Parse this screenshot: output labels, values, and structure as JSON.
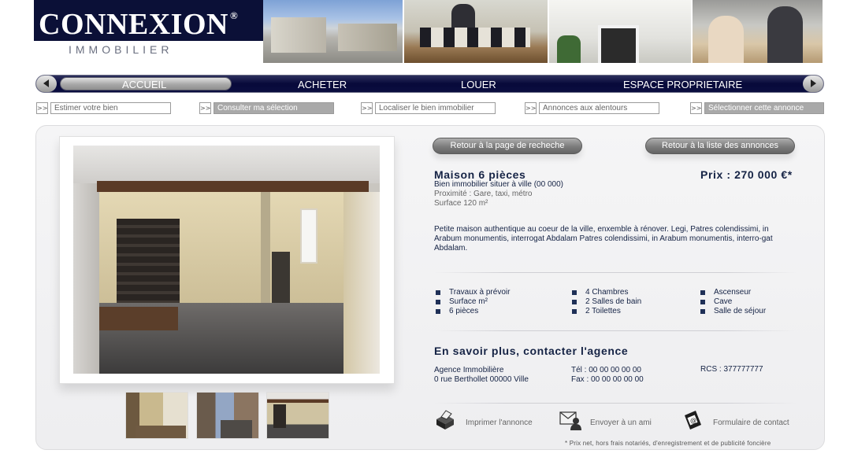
{
  "brand": {
    "name": "CONNEXION",
    "reg_mark": "®",
    "subtitle": "IMMOBILIER"
  },
  "nav": {
    "items": [
      "ACCUEIL",
      "ACHETER",
      "LOUER",
      "ESPACE PROPRIETAIRE"
    ],
    "active": "ACCUEIL",
    "prev_icon": "arrow-left-icon",
    "next_icon": "arrow-right-icon"
  },
  "sub_actions": [
    {
      "arrow": ">>",
      "label": "Estimer votre bien"
    },
    {
      "arrow": ">>",
      "label": "Consulter ma sélection"
    },
    {
      "arrow": ">>",
      "label": "Localiser le bien immobilier"
    },
    {
      "arrow": ">>",
      "label": "Annonces aux alentours"
    },
    {
      "arrow": ">>",
      "label": "Sélectionner cette annonce"
    }
  ],
  "buttons": {
    "back_search": "Retour à la page de recheche",
    "back_list": "Retour à la liste des annonces"
  },
  "listing": {
    "title": "Maison 6 pièces",
    "price": "Prix : 270 000 €*",
    "location": "Bien immobilier situer à ville (00 000)",
    "proximity": "Proximité : Gare, taxi, métro",
    "surface": "Surface 120 m²",
    "description": "Petite maison authentique au coeur de la ville, enxemble à rénover. Legi, Patres colendissimi, in Arabum monumentis, interrogat  Abdalam Patres colendissimi, in Arabum monumentis, interro-gat  Abdalam.",
    "features": [
      [
        "Travaux à prévoir",
        "Surface m²",
        "6 pièces"
      ],
      [
        "4 Chambres",
        "2 Salles de bain",
        "2 Toilettes"
      ],
      [
        "Ascenseur",
        "Cave",
        "Salle de séjour"
      ]
    ]
  },
  "contact": {
    "title": "En savoir plus, contacter l'agence",
    "agency": "Agence Immobilière",
    "address": "0 rue Berthollet    00000 Ville",
    "tel": "Tél : 00 00 00 00 00",
    "fax": "Fax : 00 00 00 00 00",
    "rcs": "RCS : 377777777"
  },
  "actions": [
    {
      "icon": "printer-icon",
      "label": "Imprimer l'annonce"
    },
    {
      "icon": "envelope-icon",
      "label": "Envoyer à un ami"
    },
    {
      "icon": "contact-form-icon",
      "label": "Formulaire de contact"
    }
  ],
  "footnote": "* Prix net, hors frais notariés, d'enregistrement et de publicité foncière",
  "colors": {
    "brand_navy": "#0b1037",
    "text_navy": "#152345",
    "panel_bg": "#f1f1f3"
  }
}
